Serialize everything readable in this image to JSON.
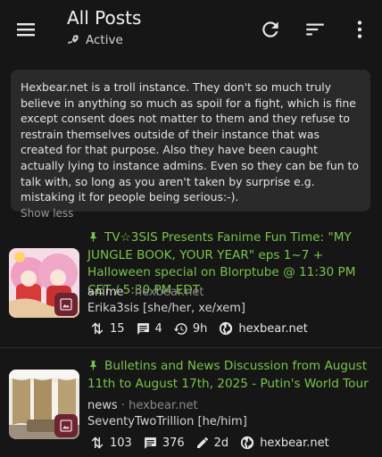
{
  "header": {
    "title": "All Posts",
    "subtitle": "Active"
  },
  "about": {
    "text": "Hexbear.net is a troll instance. They don't so much truly believe in anything so much as spoil for a fight, which is fine except consent does not matter to them and they refuse to restrain themselves outside of their instance that was created for that purpose. Also they have been caught actually lying to instance admins. Even so they can be fun to talk with, so long as you aren't taken by surprise e.g. mistaking it for people being serious:-).",
    "toggle_label": "Show less"
  },
  "posts": [
    {
      "title": "TV☆3SIS Presents Fanime Fun Time: \"MY JUNGLE BOOK, YOUR YEAR\" eps 1~7 + Halloween special on Blorptube @ 11:30 PM CET / 5:30 PM EDT",
      "community": "anime",
      "instance": "hexbear.net",
      "author": "Erika3sis [she/her, xe/xem]",
      "score": "15",
      "comments": "4",
      "age": "9h",
      "domain": "hexbear.net"
    },
    {
      "title": "Bulletins and News Discussion from August 11th to August 17th, 2025 - Putin's World Tour",
      "community": "news",
      "instance": "hexbear.net",
      "author": "SeventyTwoTrillion [he/him]",
      "score": "103",
      "comments": "376",
      "age": "2d",
      "domain": "hexbear.net"
    }
  ],
  "colors": {
    "background": "#161616",
    "card": "#2a2a2a",
    "title_green": "#79c44c",
    "thumb_badge": "#6d2431"
  },
  "icons": {
    "menu": "menu-icon",
    "active": "rocket-icon",
    "refresh": "refresh-icon",
    "sort": "sort-icon",
    "more": "more-vert-icon",
    "pin": "pin-icon",
    "score": "upvote-downvote-icon",
    "comments": "comment-icon",
    "age_recent": "history-icon",
    "age_edited": "pencil-icon",
    "domain": "globe-icon",
    "image": "image-icon"
  }
}
